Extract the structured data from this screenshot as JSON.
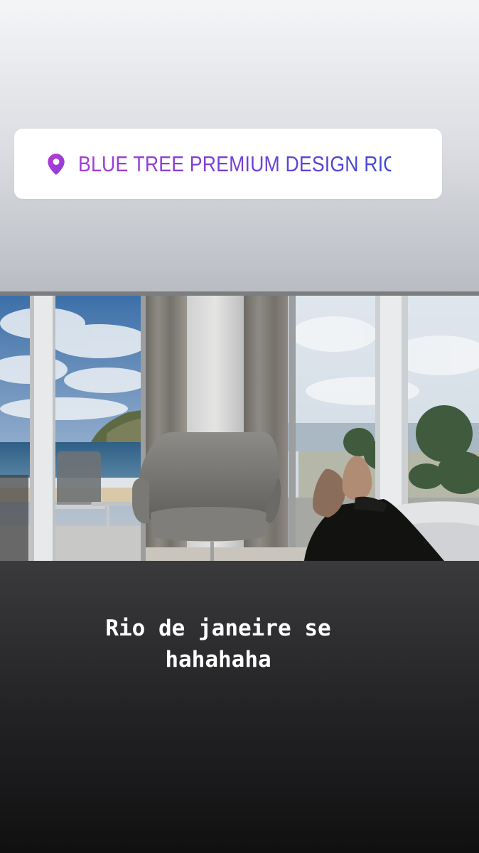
{
  "location_sticker": {
    "icon": "location-pin-icon",
    "label": "BLUE TREE PREMIUM DESIGN RIO DE..."
  },
  "caption": {
    "text": "Rio de janeire se\nhahahaha"
  },
  "colors": {
    "sticker_gradient_start": "#a93ad6",
    "sticker_gradient_end": "#3e48d8",
    "caption_text": "#ffffff"
  }
}
